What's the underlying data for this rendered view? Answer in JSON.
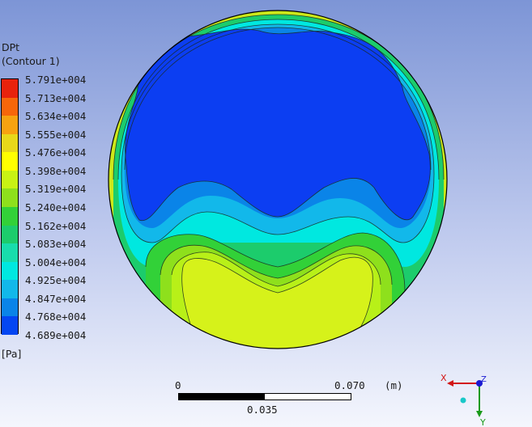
{
  "legend": {
    "variable": "DPt",
    "subtitle": "(Contour  1)",
    "unit": "[Pa]",
    "levels": [
      {
        "label": "5.791e+004",
        "color": "#e8220c"
      },
      {
        "label": "5.713e+004",
        "color": "#f7660a"
      },
      {
        "label": "5.634e+004",
        "color": "#f7a210"
      },
      {
        "label": "5.555e+004",
        "color": "#e8d81a"
      },
      {
        "label": "5.476e+004",
        "color": "#ffff00"
      },
      {
        "label": "5.398e+004",
        "color": "#c8f214"
      },
      {
        "label": "5.319e+004",
        "color": "#8ee01c"
      },
      {
        "label": "5.240e+004",
        "color": "#32d138"
      },
      {
        "label": "5.162e+004",
        "color": "#1ccc6c"
      },
      {
        "label": "5.083e+004",
        "color": "#18dcac"
      },
      {
        "label": "5.004e+004",
        "color": "#00e8e0"
      },
      {
        "label": "4.925e+004",
        "color": "#12b8ea"
      },
      {
        "label": "4.847e+004",
        "color": "#0a84e8"
      },
      {
        "label": "4.768e+004",
        "color": "#0446f2"
      },
      {
        "label": "4.689e+004",
        "color": "#0c3ef2"
      }
    ]
  },
  "scale_bar": {
    "start": "0",
    "end": "0.070",
    "unit": "(m)",
    "mid": "0.035"
  },
  "triad": {
    "x_label": "X",
    "y_label": "Y",
    "z_label": "Z",
    "x_color": "#d21616",
    "y_color": "#1a9a1a",
    "z_color": "#1a1ad2"
  }
}
